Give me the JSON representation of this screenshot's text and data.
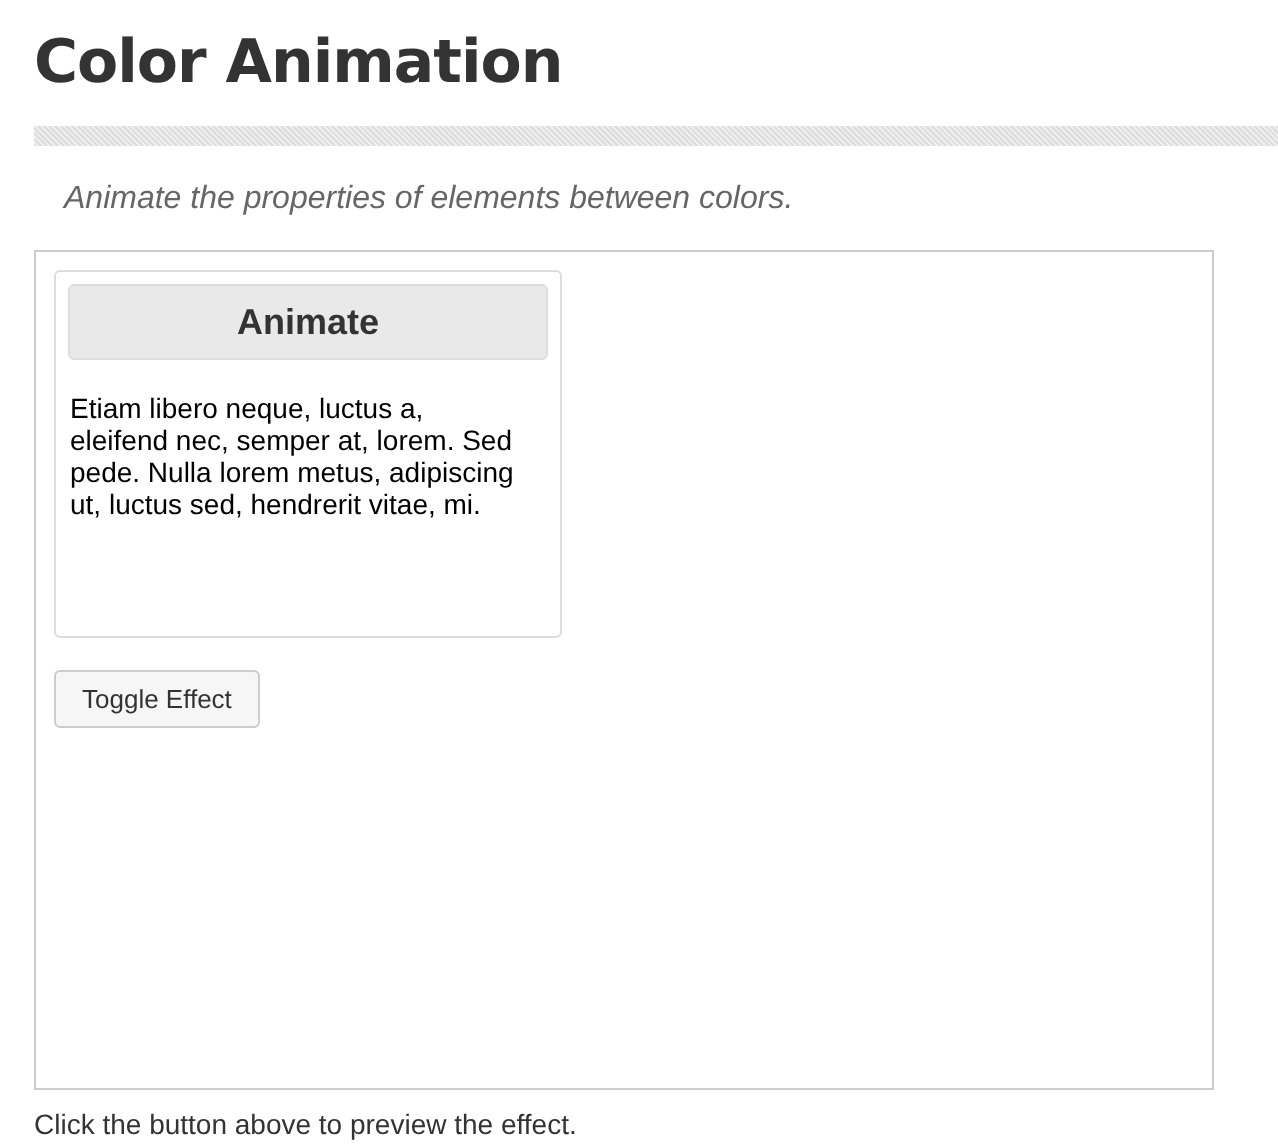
{
  "page": {
    "title": "Color Animation",
    "description": "Animate the properties of elements between colors."
  },
  "demo": {
    "panel": {
      "header": "Animate",
      "text": "Etiam libero neque, luctus a, eleifend nec, semper at, lorem. Sed pede. Nulla lorem metus, adipiscing ut, luctus sed, hendrerit vitae, mi."
    },
    "button": "Toggle Effect"
  },
  "footer_note": "Click the button above to preview the effect."
}
